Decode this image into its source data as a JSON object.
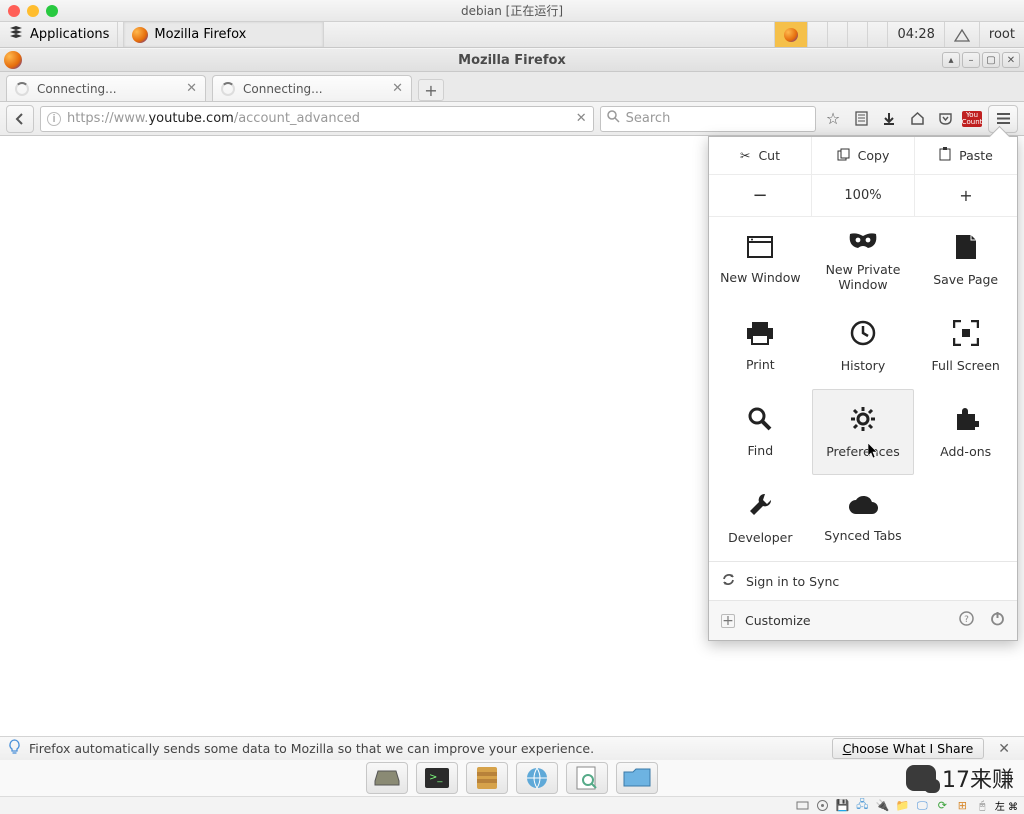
{
  "vm": {
    "title": "debian [正在运行]"
  },
  "panel": {
    "applications": "Applications",
    "task_firefox": "Mozilla Firefox",
    "clock": "04:28",
    "user": "root"
  },
  "firefox": {
    "title": "Mozilla Firefox",
    "tabs": [
      {
        "label": "Connecting..."
      },
      {
        "label": "Connecting..."
      }
    ],
    "url": {
      "proto": "https://www.",
      "host": "youtube.com",
      "path": "/account_advanced"
    },
    "search_placeholder": "Search",
    "menu": {
      "cut": "Cut",
      "copy": "Copy",
      "paste": "Paste",
      "zoom": "100%",
      "items": [
        "New Window",
        "New Private Window",
        "Save Page",
        "Print",
        "History",
        "Full Screen",
        "Find",
        "Preferences",
        "Add-ons",
        "Developer",
        "Synced Tabs"
      ],
      "sign_in": "Sign in to Sync",
      "customize": "Customize"
    },
    "infobar": {
      "text": "Firefox automatically sends some data to Mozilla so that we can improve your experience.",
      "choose_pre": "C",
      "choose_rest": "hoose What I Share"
    }
  },
  "wechat_text": "17来赚",
  "systray_lang": "左 ⌘"
}
